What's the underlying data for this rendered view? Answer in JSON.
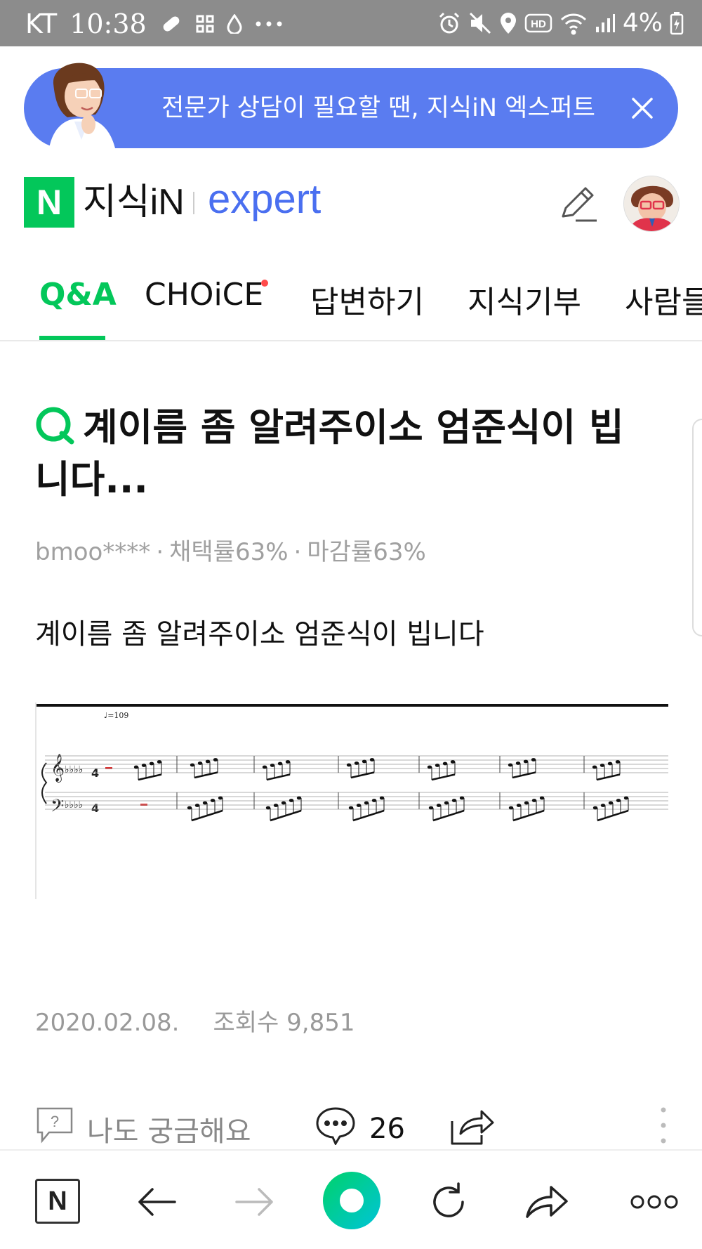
{
  "status_bar": {
    "carrier": "KT",
    "time": "10:38",
    "battery": "4%"
  },
  "banner": {
    "text": "전문가 상담이 필요할 땐, 지식iN 엑스퍼트"
  },
  "header": {
    "logo_letter": "N",
    "logo_text": "지식iN",
    "expert_text": "expert"
  },
  "tabs": [
    {
      "label": "Q&A",
      "active": true
    },
    {
      "label": "CHOiCE",
      "active": false
    },
    {
      "label": "답변하기",
      "active": false
    },
    {
      "label": "지식기부",
      "active": false
    },
    {
      "label": "사람들",
      "active": false
    }
  ],
  "question": {
    "title": "계이름 좀 알려주이소 엄준식이 빕니다...",
    "author": "bmoo****",
    "adoption_rate": "채택률63%",
    "closing_rate": "마감률63%",
    "body": "계이름 좀 알려주이소 엄준식이 빕니다",
    "tempo": "♩=109",
    "date": "2020.02.08.",
    "views": "조회수 9,851"
  },
  "actions": {
    "curious_label": "나도 궁금해요",
    "comment_count": "26"
  },
  "colors": {
    "brand_green": "#03c75a",
    "expert_blue": "#4a6ff0",
    "banner_bg": "#5a7cf0",
    "status_bar_bg": "#8c8c8c",
    "notification_dot": "#ff4a4a"
  },
  "icons": [
    "pill-icon",
    "grid-icon",
    "drop-icon",
    "more-icon",
    "alarm-icon",
    "mute-icon",
    "location-icon",
    "hd-icon",
    "wifi-icon",
    "signal-icon",
    "battery-icon",
    "close-icon",
    "pen-icon",
    "profile-avatar",
    "question-mark-icon",
    "speech-bubble-icon",
    "share-icon",
    "kebab-icon",
    "back-arrow-icon",
    "forward-arrow-icon",
    "refresh-icon",
    "forward-share-icon",
    "more-dots-icon"
  ]
}
